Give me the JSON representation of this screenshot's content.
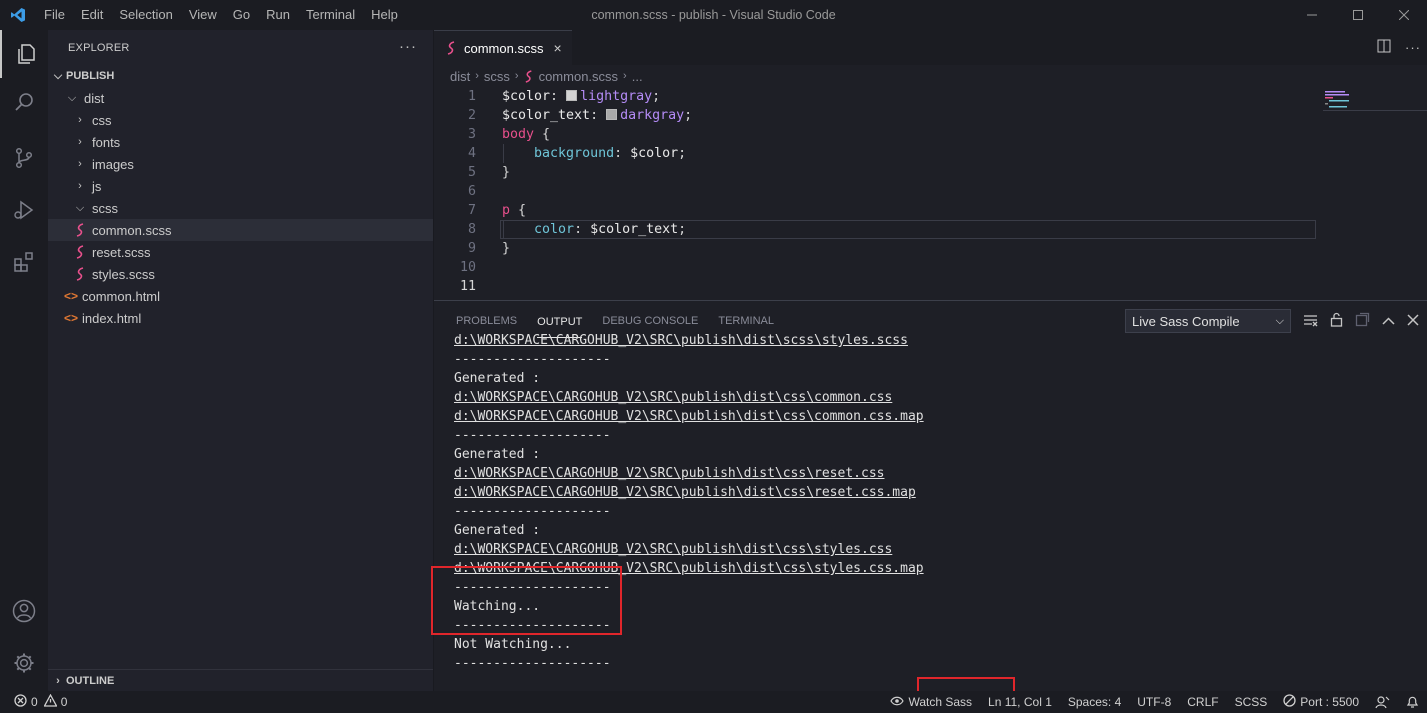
{
  "window": {
    "title": "common.scss - publish - Visual Studio Code"
  },
  "menu": [
    "File",
    "Edit",
    "Selection",
    "View",
    "Go",
    "Run",
    "Terminal",
    "Help"
  ],
  "sidebar": {
    "header": "EXPLORER",
    "more": "···",
    "root": "PUBLISH",
    "tree": [
      {
        "label": "dist",
        "kind": "folder-open",
        "depth": 1
      },
      {
        "label": "css",
        "kind": "folder",
        "depth": 2
      },
      {
        "label": "fonts",
        "kind": "folder",
        "depth": 2
      },
      {
        "label": "images",
        "kind": "folder",
        "depth": 2
      },
      {
        "label": "js",
        "kind": "folder",
        "depth": 2
      },
      {
        "label": "scss",
        "kind": "folder-open",
        "depth": 2
      },
      {
        "label": "common.scss",
        "kind": "scss",
        "depth": 3,
        "selected": true
      },
      {
        "label": "reset.scss",
        "kind": "scss",
        "depth": 3
      },
      {
        "label": "styles.scss",
        "kind": "scss",
        "depth": 3
      },
      {
        "label": "common.html",
        "kind": "html",
        "depth": 1
      },
      {
        "label": "index.html",
        "kind": "html",
        "depth": 1
      }
    ],
    "outline": "OUTLINE"
  },
  "editor": {
    "tab": {
      "label": "common.scss",
      "close": "×"
    },
    "breadcrumb": [
      "dist",
      "scss",
      "common.scss",
      "..."
    ],
    "lines": [
      {
        "num": "1",
        "text": "$color: lightgray;"
      },
      {
        "num": "2",
        "text": "$color_text: darkgray;"
      },
      {
        "num": "3",
        "text": "body {"
      },
      {
        "num": "4",
        "text": "    background: $color;"
      },
      {
        "num": "5",
        "text": "}"
      },
      {
        "num": "6",
        "text": ""
      },
      {
        "num": "7",
        "text": "p {"
      },
      {
        "num": "8",
        "text": "    color: $color_text;"
      },
      {
        "num": "9",
        "text": "}"
      },
      {
        "num": "10",
        "text": ""
      },
      {
        "num": "11",
        "text": ""
      }
    ]
  },
  "panel": {
    "tabs": [
      "PROBLEMS",
      "OUTPUT",
      "DEBUG CONSOLE",
      "TERMINAL"
    ],
    "active_tab": "OUTPUT",
    "channel": "Live Sass Compile",
    "output": [
      {
        "text": "d:\\WORKSPACE\\CARGOHUB_V2\\SRC\\publish\\dist\\scss\\styles.scss",
        "link": true
      },
      {
        "text": "--------------------",
        "link": false
      },
      {
        "text": "Generated :",
        "link": false
      },
      {
        "text": "d:\\WORKSPACE\\CARGOHUB_V2\\SRC\\publish\\dist\\css\\common.css",
        "link": true
      },
      {
        "text": "d:\\WORKSPACE\\CARGOHUB_V2\\SRC\\publish\\dist\\css\\common.css.map",
        "link": true
      },
      {
        "text": "--------------------",
        "link": false
      },
      {
        "text": "Generated :",
        "link": false
      },
      {
        "text": "d:\\WORKSPACE\\CARGOHUB_V2\\SRC\\publish\\dist\\css\\reset.css",
        "link": true
      },
      {
        "text": "d:\\WORKSPACE\\CARGOHUB_V2\\SRC\\publish\\dist\\css\\reset.css.map",
        "link": true
      },
      {
        "text": "--------------------",
        "link": false
      },
      {
        "text": "Generated :",
        "link": false
      },
      {
        "text": "d:\\WORKSPACE\\CARGOHUB_V2\\SRC\\publish\\dist\\css\\styles.css",
        "link": true
      },
      {
        "text": "d:\\WORKSPACE\\CARGOHUB_V2\\SRC\\publish\\dist\\css\\styles.css.map",
        "link": true
      },
      {
        "text": "--------------------",
        "link": false
      },
      {
        "text": "Watching...",
        "link": false
      },
      {
        "text": "--------------------",
        "link": false
      },
      {
        "text": "Not Watching...",
        "link": false
      },
      {
        "text": "--------------------",
        "link": false
      }
    ]
  },
  "statusbar": {
    "errors": "0",
    "warnings": "0",
    "watch_sass": "Watch Sass",
    "position": "Ln 11, Col 1",
    "spaces": "Spaces: 4",
    "encoding": "UTF-8",
    "eol": "CRLF",
    "language": "SCSS",
    "port": "Port : 5500"
  },
  "colors": {
    "scss_icon": "#e8508c",
    "html_icon": "#e37933",
    "keyword": "#e8508c",
    "variable": "#e8e8e8",
    "value": "#b58cf7",
    "property": "#6fc5d8",
    "highlight": "#e0262b"
  }
}
